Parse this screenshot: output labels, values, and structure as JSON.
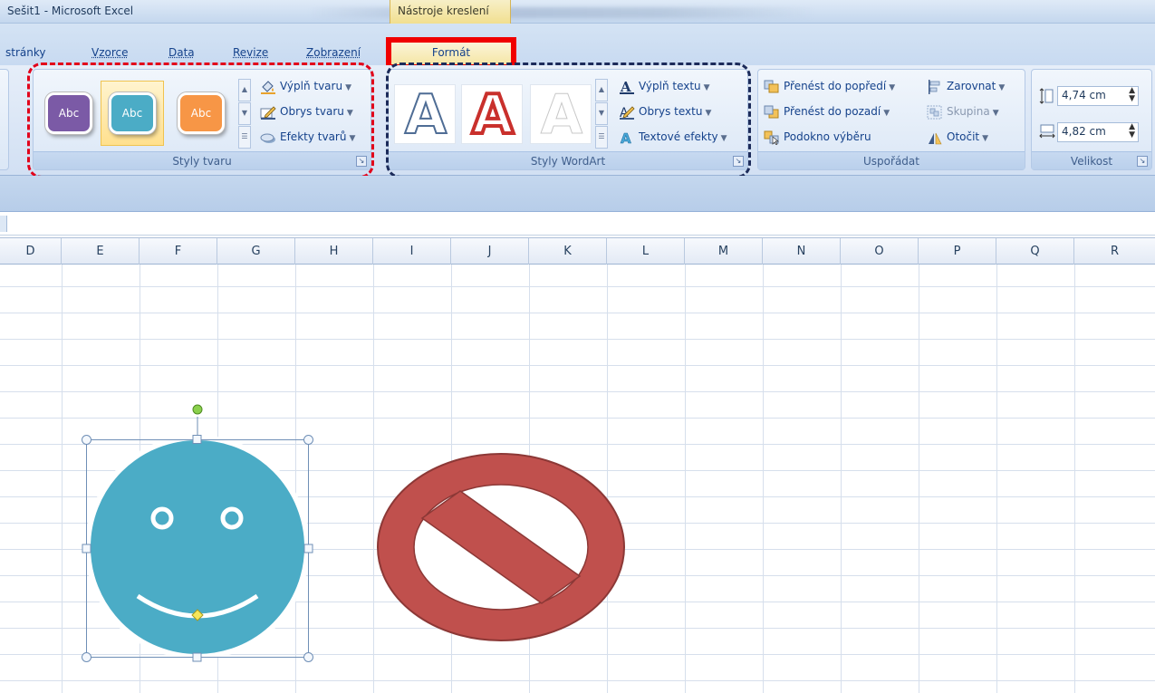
{
  "window": {
    "title": "Sešit1 - Microsoft Excel",
    "contextual_tab_group": "Nástroje kreslení"
  },
  "tabs": [
    {
      "label": "stránky"
    },
    {
      "label": "Vzorce"
    },
    {
      "label": "Data"
    },
    {
      "label": "Revize"
    },
    {
      "label": "Zobrazení"
    }
  ],
  "active_tab": {
    "label": "Formát"
  },
  "groups": {
    "shape_styles": {
      "label": "Styly tvaru",
      "styles": [
        {
          "text": "Abc",
          "color": "#7b5aa6"
        },
        {
          "text": "Abc",
          "color": "#4bacc6"
        },
        {
          "text": "Abc",
          "color": "#f79646"
        }
      ],
      "commands": {
        "fill": "Výplň tvaru",
        "outline": "Obrys tvaru",
        "effects": "Efekty tvarů"
      }
    },
    "wordart_styles": {
      "label": "Styly WordArt",
      "samples": [
        {
          "glyph": "A"
        },
        {
          "glyph": "A"
        },
        {
          "glyph": "A"
        }
      ],
      "commands": {
        "fill": "Výplň textu",
        "outline": "Obrys textu",
        "effects": "Textové efekty"
      }
    },
    "arrange": {
      "label": "Uspořádat",
      "commands": {
        "bring_forward": "Přenést do popředí",
        "send_backward": "Přenést do pozadí",
        "selection_pane": "Podokno výběru",
        "align": "Zarovnat",
        "group": "Skupina",
        "rotate": "Otočit"
      }
    },
    "size": {
      "label": "Velikost",
      "height": "4,74 cm",
      "width": "4,82 cm"
    }
  },
  "columns": [
    "D",
    "E",
    "F",
    "G",
    "H",
    "I",
    "J",
    "K",
    "L",
    "M",
    "N",
    "O",
    "P",
    "Q",
    "R"
  ],
  "colors": {
    "smiley": "#4bacc6",
    "no_symbol": "#c0504d",
    "highlight_red": "#e2001a",
    "highlight_navy": "#1c2b5a"
  }
}
